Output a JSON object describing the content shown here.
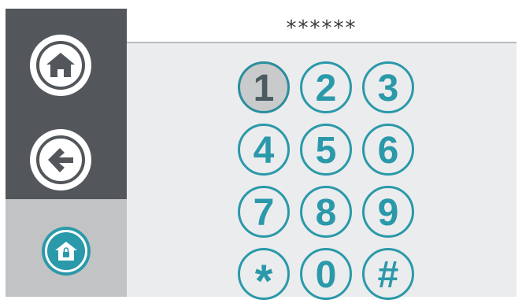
{
  "sidebar": {
    "home_icon": "home-icon",
    "back_icon": "arrow-left-icon",
    "lock_icon": "house-lock-icon"
  },
  "display": {
    "masked_code": "******"
  },
  "keypad": {
    "keys": [
      "1",
      "2",
      "3",
      "4",
      "5",
      "6",
      "7",
      "8",
      "9",
      "*",
      "0",
      "#"
    ],
    "pressed_key": "1"
  },
  "colors": {
    "accent": "#2a99a9",
    "sidebar_dark": "#53575b",
    "sidebar_light": "#c2c3c5",
    "panel": "#ebecee"
  }
}
